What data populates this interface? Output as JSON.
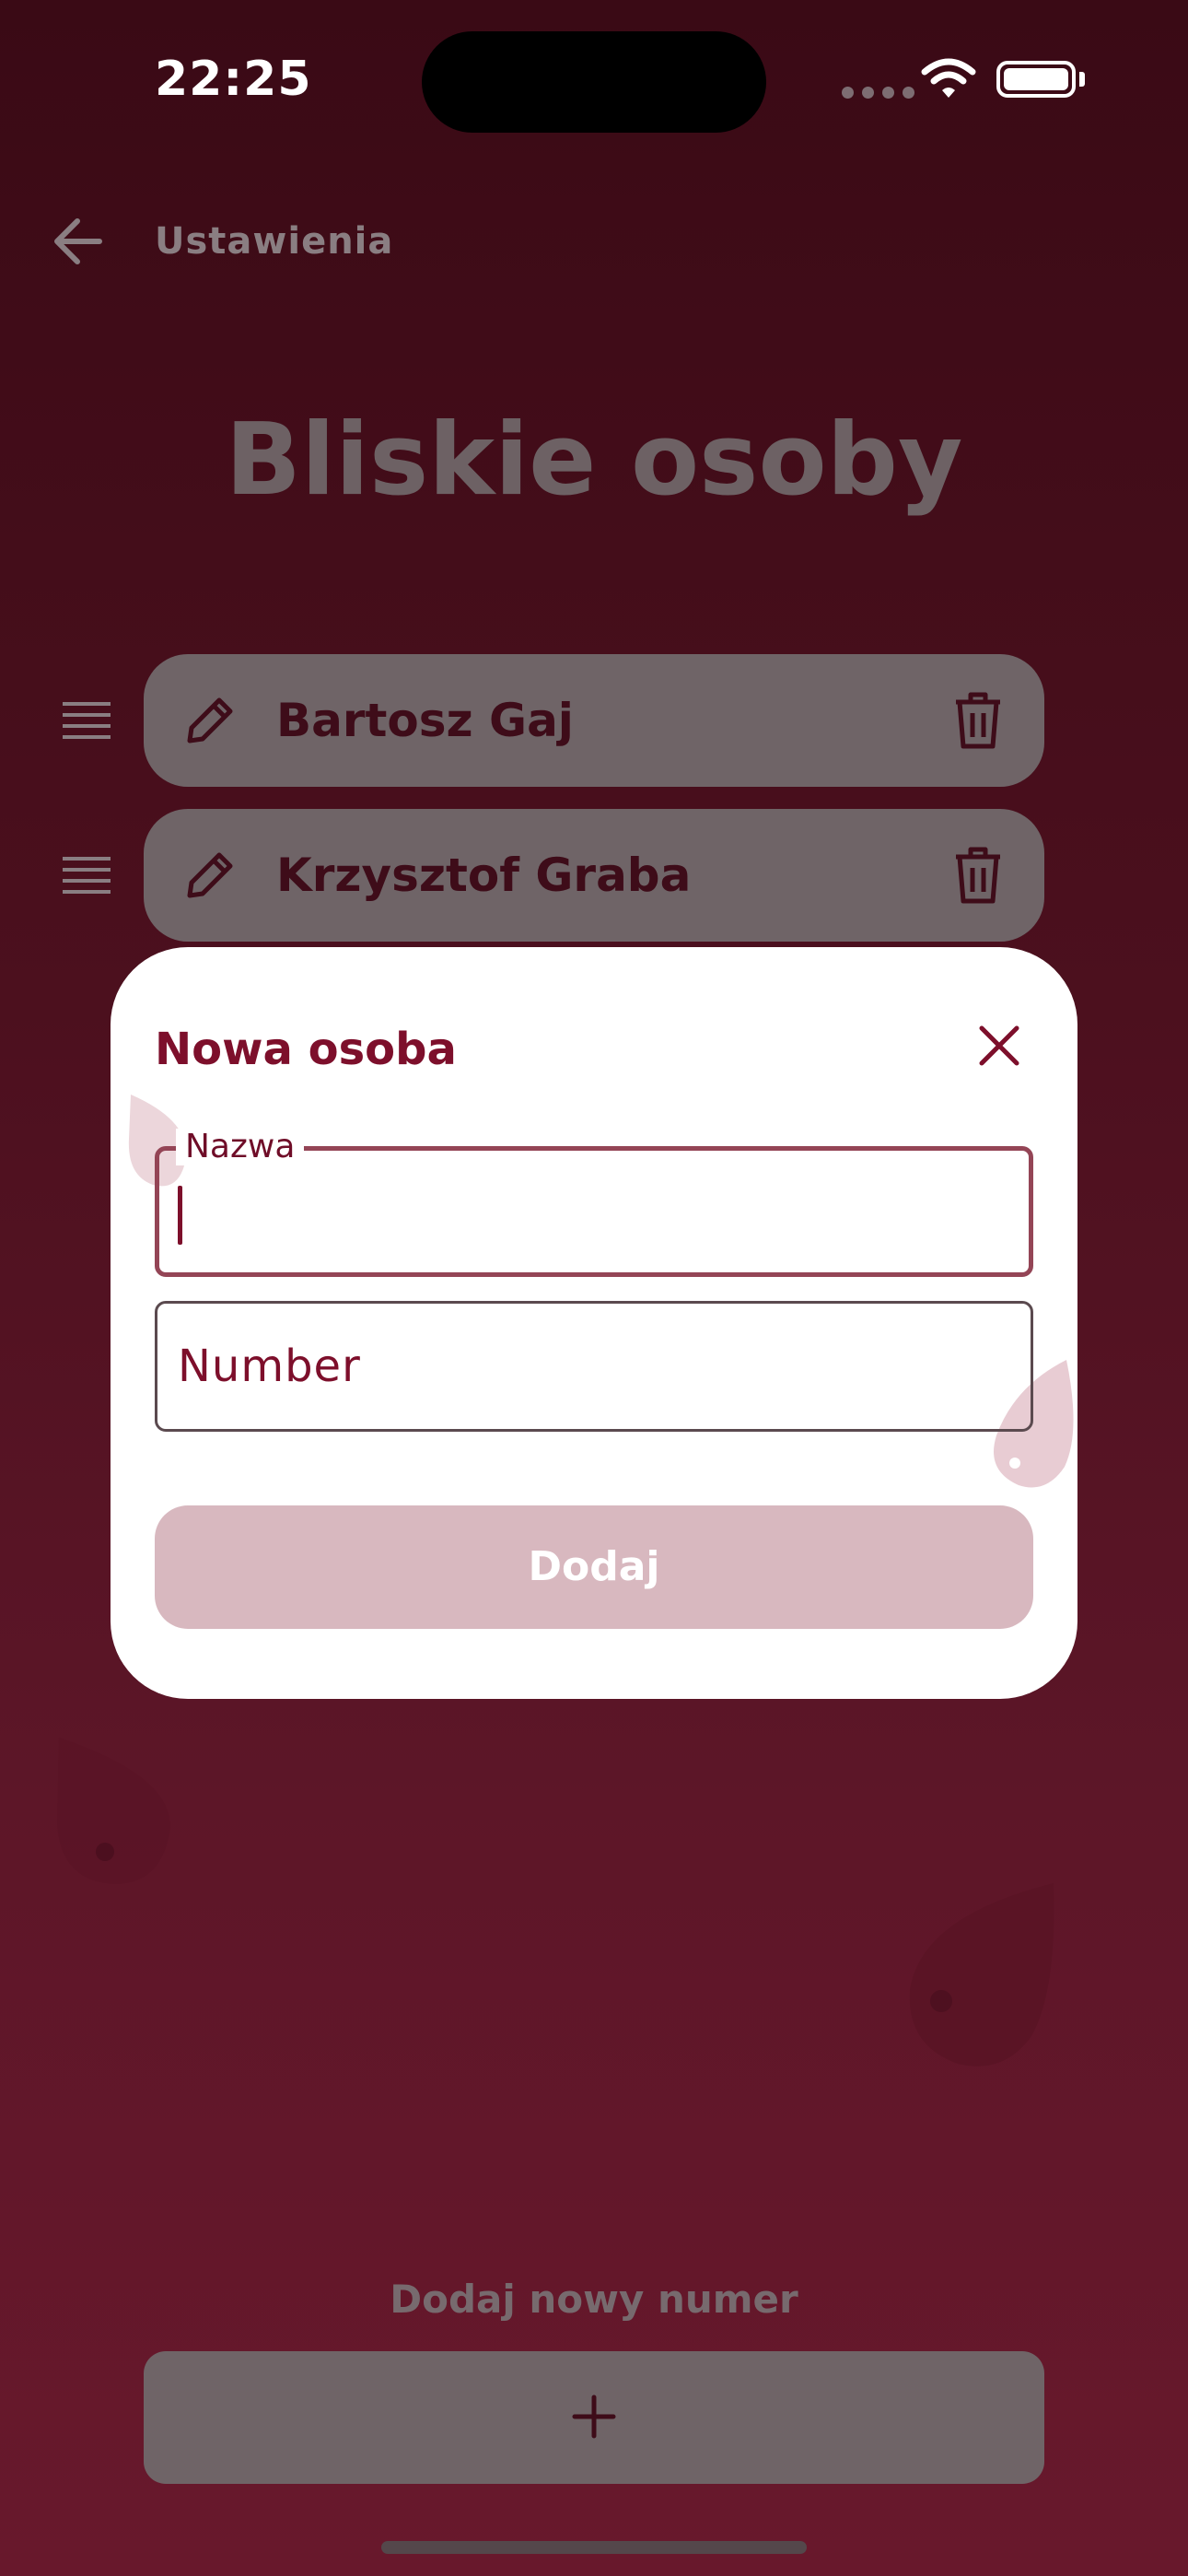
{
  "status_bar": {
    "time": "22:25"
  },
  "nav": {
    "back_icon": "arrow-left-icon",
    "title": "Ustawienia"
  },
  "page": {
    "title": "Bliskie osoby"
  },
  "contacts": [
    {
      "name": "Bartosz Gaj"
    },
    {
      "name": "Krzysztof Graba"
    }
  ],
  "footer": {
    "add_label": "Dodaj nowy numer",
    "add_icon": "plus-icon"
  },
  "dialog": {
    "title": "Nowa osoba",
    "name_field": {
      "label": "Nazwa",
      "value": ""
    },
    "number_field": {
      "placeholder": "Number",
      "value": ""
    },
    "submit_label": "Dodaj"
  },
  "colors": {
    "accent": "#7d0f2b",
    "background_top": "#3a0a15",
    "background_bottom": "#68182c",
    "disabled_button": "#d8b8bf",
    "row_fill": "#6f6467"
  }
}
